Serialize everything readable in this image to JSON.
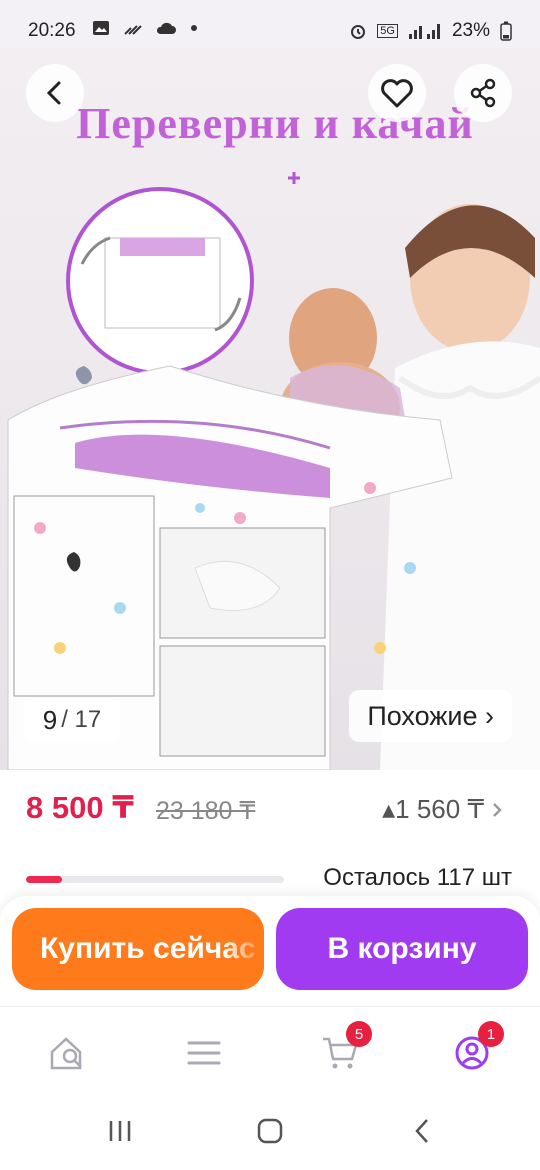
{
  "status_bar": {
    "time": "20:26",
    "battery": "23%",
    "network": "5G"
  },
  "hero": {
    "banner_text": "Переверни и качай",
    "image_index": "9",
    "image_total": "/ 17",
    "similar_label": "Похожие ›"
  },
  "price": {
    "current": "8 500 ₸",
    "old": "23 180 ₸",
    "cashback": "▴1 560 ₸"
  },
  "stock": {
    "text": "Осталось 117 шт",
    "fill_fraction": 0.14
  },
  "actions": {
    "buy_now": "Купить сейчас",
    "add_to_cart": "В корзину"
  },
  "bottom_nav": {
    "cart_badge": "5",
    "profile_badge": "1"
  },
  "colors": {
    "price": "#e0204f",
    "buy_button": "#ff7a1a",
    "cart_button": "#a13bf2",
    "title_accent": "#c262d8"
  }
}
